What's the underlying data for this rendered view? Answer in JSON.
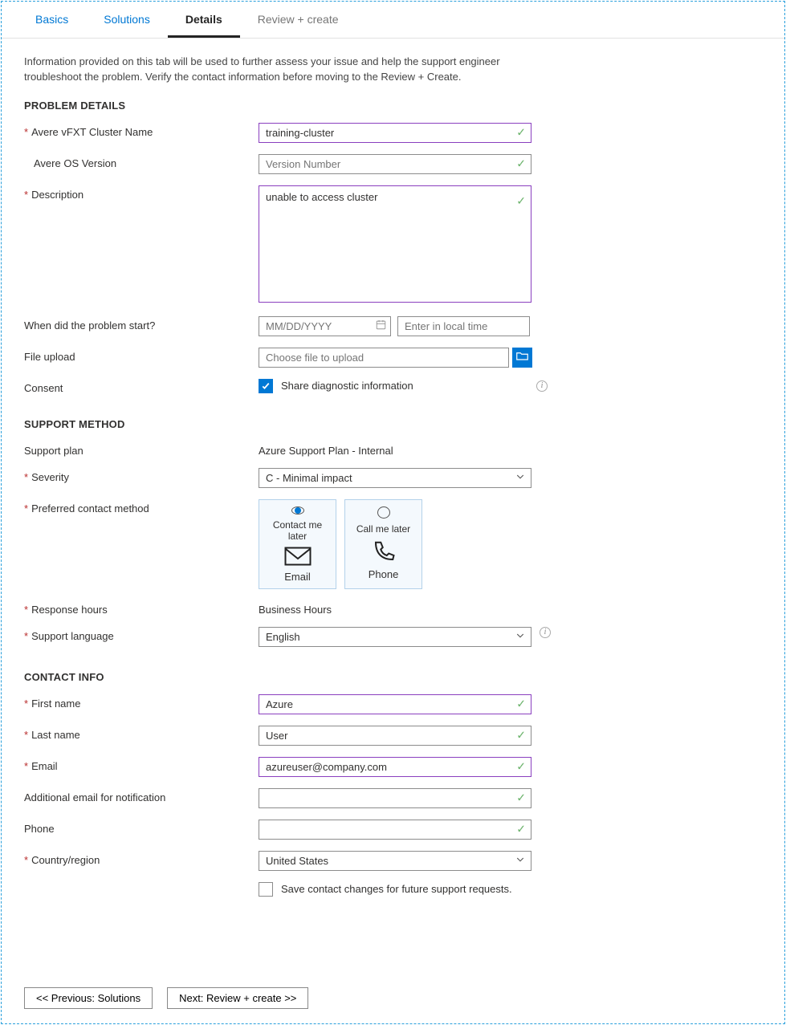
{
  "tabs": {
    "basics": "Basics",
    "solutions": "Solutions",
    "details": "Details",
    "review": "Review + create"
  },
  "intro": "Information provided on this tab will be used to further assess your issue and help the support engineer troubleshoot the problem. Verify the contact information before moving to the Review + Create.",
  "sections": {
    "problem": "PROBLEM DETAILS",
    "support": "SUPPORT METHOD",
    "contact": "CONTACT INFO"
  },
  "labels": {
    "cluster": "Avere vFXT Cluster Name",
    "os": "Avere OS Version",
    "desc": "Description",
    "when": "When did the problem start?",
    "fileup": "File upload",
    "consent": "Consent",
    "plan": "Support plan",
    "severity": "Severity",
    "contactMethod": "Preferred contact method",
    "respHours": "Response hours",
    "lang": "Support language",
    "fname": "First name",
    "lname": "Last name",
    "email": "Email",
    "addlEmail": "Additional email for notification",
    "phone": "Phone",
    "country": "Country/region"
  },
  "values": {
    "cluster": "training-cluster",
    "desc": "unable to access cluster",
    "plan": "Azure Support Plan - Internal",
    "severity": "C - Minimal impact",
    "respHours": "Business Hours",
    "lang": "English",
    "fname": "Azure",
    "lname": "User",
    "email": "azureuser@company.com",
    "addlEmail": "",
    "phone": "",
    "country": "United States"
  },
  "placeholders": {
    "os": "Version Number",
    "date": "MM/DD/YYYY",
    "time": "Enter in local time",
    "file": "Choose file to upload"
  },
  "consentLabel": "Share diagnostic information",
  "saveContact": "Save contact changes for future support requests.",
  "cards": {
    "emailTop": "Contact me later",
    "emailCap": "Email",
    "phoneTop": "Call me later",
    "phoneCap": "Phone"
  },
  "footer": {
    "prev": "<< Previous: Solutions",
    "next": "Next: Review + create >>"
  }
}
